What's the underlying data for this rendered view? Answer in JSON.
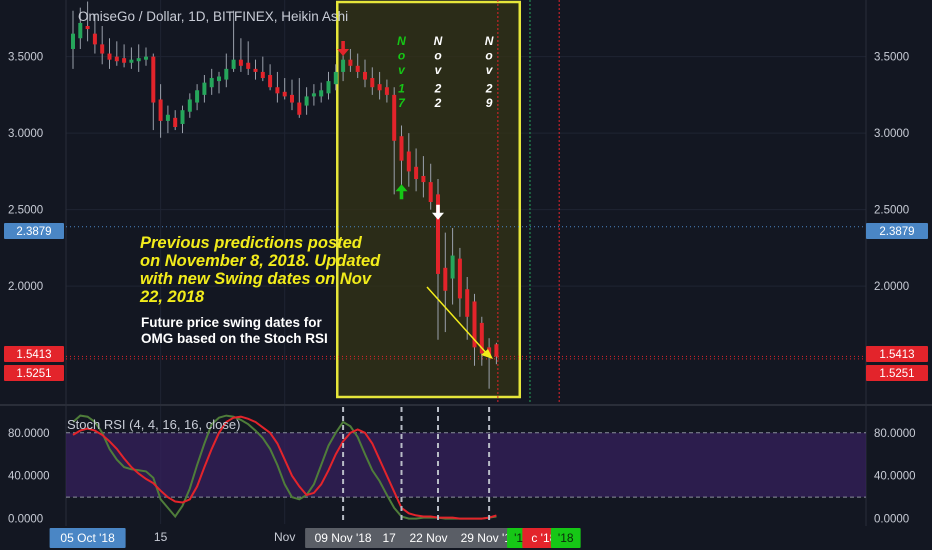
{
  "title": "OmiseGo / Dollar, 1D, BITFINEX, Heikin Ashi",
  "colors": {
    "background": "#131722",
    "grid": "#1f2433",
    "text": "#c8ccd6",
    "up": "#26a65b",
    "down": "#e3242b",
    "highlight_box": "#e6e63a",
    "rsi_k": "#e3242b",
    "rsi_d": "#4f7d3a",
    "rsi_band": "#35205c",
    "price_tag_blue": "#4a86c5",
    "price_tag_red": "#e3242b",
    "date_tag_blue": "#4a86c5",
    "date_tag_gray": "#5a5e66",
    "date_tag_green": "#16c716",
    "annotation_yellow": "#f2ec1b"
  },
  "price_axis": {
    "ticks": [
      "3.5000",
      "3.0000",
      "2.5000",
      "2.0000"
    ],
    "tick_values": [
      3.5,
      3.0,
      2.5,
      2.0
    ],
    "ylim": [
      1.23,
      3.87
    ],
    "tags": [
      {
        "label": "2.3879",
        "value": 2.3879,
        "style": "blue"
      },
      {
        "label": "1.5413",
        "value": 1.5413,
        "style": "red"
      },
      {
        "label": "1.5251",
        "value": 1.5251,
        "style": "red"
      }
    ]
  },
  "rsi": {
    "label": "Stoch RSI (4, 4, 16, 16, close)",
    "ticks": [
      "80.0000",
      "40.0000",
      "0.0000"
    ],
    "tick_values": [
      80,
      40,
      0
    ],
    "band": [
      20,
      80
    ],
    "ylim": [
      -5,
      104
    ]
  },
  "time_axis": {
    "labels": [
      {
        "text": "Oct",
        "bar": 0.5,
        "style": "plain"
      },
      {
        "text": "05 Oct '18",
        "bar": 2,
        "style": "blue"
      },
      {
        "text": "15",
        "bar": 12,
        "style": "plain"
      },
      {
        "text": "Nov",
        "bar": 29,
        "style": "plain"
      },
      {
        "text": "09 Nov '18",
        "bar": 37,
        "style": "gray"
      },
      {
        "text": "17 Nov",
        "bar": 45,
        "style": "gray"
      },
      {
        "text": "22 Nov '18",
        "bar": 50,
        "style": "gray"
      },
      {
        "text": "29 Nov '18",
        "bar": 57,
        "style": "gray"
      },
      {
        "text": "'18",
        "bar": 61.5,
        "style": "green"
      },
      {
        "text": "c '18",
        "bar": 64.5,
        "style": "red"
      },
      {
        "text": "'18",
        "bar": 67.5,
        "style": "green"
      }
    ]
  },
  "swing_dates": [
    {
      "chars": [
        "N",
        "o",
        "v",
        "1",
        "7"
      ],
      "color": "#16c716",
      "bar": 45
    },
    {
      "chars": [
        "N",
        "o",
        "v",
        "2",
        "2"
      ],
      "color": "#ffffff",
      "bar": 50
    },
    {
      "chars": [
        "N",
        "o",
        "v",
        "2",
        "9"
      ],
      "color": "#ffffff",
      "bar": 57
    }
  ],
  "annotations": {
    "main_text": [
      "Previous predictions posted",
      "on November 8, 2018. Updated",
      "with new Swing dates on Nov",
      "22, 2018"
    ],
    "sub_text": [
      "Future price swing dates for",
      "OMG based on the Stoch RSI"
    ]
  },
  "arrows": [
    {
      "direction": "down",
      "color": "#e3242b",
      "bar": 37,
      "value": 3.55
    },
    {
      "direction": "up",
      "color": "#16c716",
      "bar": 45,
      "value": 2.62
    },
    {
      "direction": "down",
      "color": "#ffffff",
      "bar": 50,
      "value": 2.48
    }
  ],
  "chart_data": {
    "type": "candlestick",
    "title": "OmiseGo / Dollar, 1D, BITFINEX, Heikin Ashi",
    "x_unit": "daily bars",
    "candles": [
      {
        "o": 3.55,
        "h": 3.8,
        "l": 3.42,
        "c": 3.65
      },
      {
        "o": 3.62,
        "h": 3.82,
        "l": 3.55,
        "c": 3.72
      },
      {
        "o": 3.7,
        "h": 3.86,
        "l": 3.6,
        "c": 3.68
      },
      {
        "o": 3.65,
        "h": 3.78,
        "l": 3.52,
        "c": 3.58
      },
      {
        "o": 3.58,
        "h": 3.7,
        "l": 3.45,
        "c": 3.52
      },
      {
        "o": 3.52,
        "h": 3.62,
        "l": 3.42,
        "c": 3.48
      },
      {
        "o": 3.5,
        "h": 3.6,
        "l": 3.44,
        "c": 3.47
      },
      {
        "o": 3.49,
        "h": 3.58,
        "l": 3.43,
        "c": 3.46
      },
      {
        "o": 3.46,
        "h": 3.56,
        "l": 3.42,
        "c": 3.48
      },
      {
        "o": 3.47,
        "h": 3.58,
        "l": 3.4,
        "c": 3.49
      },
      {
        "o": 3.48,
        "h": 3.56,
        "l": 3.44,
        "c": 3.5
      },
      {
        "o": 3.5,
        "h": 3.52,
        "l": 3.02,
        "c": 3.2
      },
      {
        "o": 3.22,
        "h": 3.32,
        "l": 2.97,
        "c": 3.08
      },
      {
        "o": 3.08,
        "h": 3.18,
        "l": 3.0,
        "c": 3.12
      },
      {
        "o": 3.1,
        "h": 3.15,
        "l": 3.02,
        "c": 3.04
      },
      {
        "o": 3.06,
        "h": 3.18,
        "l": 3.0,
        "c": 3.15
      },
      {
        "o": 3.14,
        "h": 3.26,
        "l": 3.1,
        "c": 3.22
      },
      {
        "o": 3.2,
        "h": 3.32,
        "l": 3.15,
        "c": 3.28
      },
      {
        "o": 3.25,
        "h": 3.38,
        "l": 3.2,
        "c": 3.33
      },
      {
        "o": 3.3,
        "h": 3.42,
        "l": 3.25,
        "c": 3.36
      },
      {
        "o": 3.34,
        "h": 3.4,
        "l": 3.26,
        "c": 3.37
      },
      {
        "o": 3.35,
        "h": 3.52,
        "l": 3.3,
        "c": 3.42
      },
      {
        "o": 3.42,
        "h": 3.8,
        "l": 3.4,
        "c": 3.48
      },
      {
        "o": 3.48,
        "h": 3.62,
        "l": 3.4,
        "c": 3.44
      },
      {
        "o": 3.46,
        "h": 3.6,
        "l": 3.38,
        "c": 3.42
      },
      {
        "o": 3.42,
        "h": 3.48,
        "l": 3.35,
        "c": 3.4
      },
      {
        "o": 3.4,
        "h": 3.5,
        "l": 3.34,
        "c": 3.36
      },
      {
        "o": 3.38,
        "h": 3.45,
        "l": 3.28,
        "c": 3.3
      },
      {
        "o": 3.3,
        "h": 3.4,
        "l": 3.2,
        "c": 3.26
      },
      {
        "o": 3.27,
        "h": 3.36,
        "l": 3.22,
        "c": 3.24
      },
      {
        "o": 3.25,
        "h": 3.35,
        "l": 3.15,
        "c": 3.2
      },
      {
        "o": 3.2,
        "h": 3.36,
        "l": 3.1,
        "c": 3.12
      },
      {
        "o": 3.18,
        "h": 3.3,
        "l": 3.12,
        "c": 3.24
      },
      {
        "o": 3.24,
        "h": 3.32,
        "l": 3.18,
        "c": 3.26
      },
      {
        "o": 3.24,
        "h": 3.33,
        "l": 3.2,
        "c": 3.28
      },
      {
        "o": 3.26,
        "h": 3.4,
        "l": 3.22,
        "c": 3.34
      },
      {
        "o": 3.32,
        "h": 3.45,
        "l": 3.28,
        "c": 3.4
      },
      {
        "o": 3.4,
        "h": 3.56,
        "l": 3.34,
        "c": 3.48
      },
      {
        "o": 3.48,
        "h": 3.55,
        "l": 3.4,
        "c": 3.44
      },
      {
        "o": 3.44,
        "h": 3.52,
        "l": 3.36,
        "c": 3.4
      },
      {
        "o": 3.4,
        "h": 3.48,
        "l": 3.3,
        "c": 3.35
      },
      {
        "o": 3.36,
        "h": 3.43,
        "l": 3.25,
        "c": 3.3
      },
      {
        "o": 3.32,
        "h": 3.4,
        "l": 3.22,
        "c": 3.28
      },
      {
        "o": 3.3,
        "h": 3.35,
        "l": 3.2,
        "c": 3.25
      },
      {
        "o": 3.25,
        "h": 3.3,
        "l": 2.6,
        "c": 2.95
      },
      {
        "o": 2.98,
        "h": 3.05,
        "l": 2.65,
        "c": 2.82
      },
      {
        "o": 2.88,
        "h": 3.0,
        "l": 2.65,
        "c": 2.75
      },
      {
        "o": 2.78,
        "h": 2.9,
        "l": 2.62,
        "c": 2.7
      },
      {
        "o": 2.72,
        "h": 2.85,
        "l": 2.58,
        "c": 2.68
      },
      {
        "o": 2.68,
        "h": 2.8,
        "l": 2.5,
        "c": 2.55
      },
      {
        "o": 2.6,
        "h": 2.7,
        "l": 1.65,
        "c": 2.08
      },
      {
        "o": 2.12,
        "h": 2.35,
        "l": 1.7,
        "c": 1.97
      },
      {
        "o": 2.05,
        "h": 2.38,
        "l": 1.88,
        "c": 2.2
      },
      {
        "o": 2.18,
        "h": 2.25,
        "l": 1.8,
        "c": 1.92
      },
      {
        "o": 1.98,
        "h": 2.06,
        "l": 1.65,
        "c": 1.8
      },
      {
        "o": 1.9,
        "h": 1.95,
        "l": 1.48,
        "c": 1.6
      },
      {
        "o": 1.76,
        "h": 1.8,
        "l": 1.48,
        "c": 1.56
      },
      {
        "o": 1.6,
        "h": 1.66,
        "l": 1.33,
        "c": 1.54
      },
      {
        "o": 1.62,
        "h": 1.63,
        "l": 1.49,
        "c": 1.54
      }
    ],
    "stoch_rsi": {
      "k": [
        78,
        82,
        84,
        82,
        78,
        72,
        65,
        56,
        48,
        42,
        37,
        33,
        26,
        20,
        16,
        15,
        18,
        30,
        48,
        65,
        80,
        90,
        94,
        95,
        93,
        90,
        85,
        80,
        70,
        55,
        40,
        30,
        22,
        24,
        32,
        45,
        60,
        72,
        80,
        83,
        80,
        70,
        55,
        40,
        25,
        10,
        5,
        3,
        2,
        2,
        1,
        1,
        1,
        0,
        0,
        0,
        0,
        1,
        3
      ],
      "d": [
        90,
        96,
        95,
        90,
        80,
        65,
        55,
        48,
        46,
        45,
        44,
        38,
        18,
        10,
        2,
        12,
        28,
        50,
        70,
        88,
        94,
        96,
        95,
        92,
        88,
        82,
        75,
        65,
        50,
        32,
        20,
        18,
        22,
        32,
        50,
        68,
        80,
        90,
        86,
        76,
        60,
        45,
        35,
        22,
        10,
        2,
        0,
        0,
        1,
        1,
        1,
        0,
        0,
        0,
        0,
        0,
        0,
        1,
        2
      ]
    },
    "price_ylim": [
      1.23,
      3.87
    ],
    "rsi_ylim": [
      -5,
      104
    ],
    "highlight_range_bars": [
      36.2,
      61.2
    ]
  }
}
